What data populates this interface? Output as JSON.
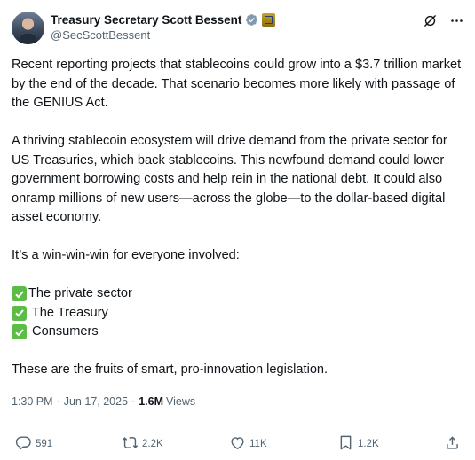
{
  "author": {
    "display_name": "Treasury Secretary Scott Bessent",
    "handle": "@SecScottBessent"
  },
  "icons": {
    "verified": "verified-badge-icon",
    "affiliation": "government-seal-icon",
    "grok": "grok-icon",
    "more": "more-icon"
  },
  "tweet": {
    "paragraph_1": "Recent reporting projects that stablecoins could grow into a $3.7 trillion market by the end of the decade. That scenario becomes more likely with passage of the GENIUS Act.",
    "paragraph_2": "A thriving stablecoin ecosystem will drive demand from the private sector for US Treasuries, which back stablecoins. This newfound demand could lower government borrowing costs and help rein in the national debt. It could also onramp millions of new users—across the globe—to the dollar-based digital asset economy.",
    "paragraph_3": "It’s a win-win-win for everyone involved:",
    "checklist": [
      "The private sector",
      " The Treasury",
      " Consumers"
    ],
    "paragraph_4": "These are the fruits of smart, pro-innovation legislation."
  },
  "meta": {
    "time": "1:30 PM",
    "date": "Jun 17, 2025",
    "separator": "·",
    "views_count": "1.6M",
    "views_label": "Views"
  },
  "actions": {
    "replies": "591",
    "reposts": "2.2K",
    "likes": "11K",
    "bookmarks": "1.2K"
  },
  "colors": {
    "text": "#0f1419",
    "secondary": "#536471",
    "verified_blue": "#1d9bf0",
    "check_green": "#5bbd46"
  }
}
